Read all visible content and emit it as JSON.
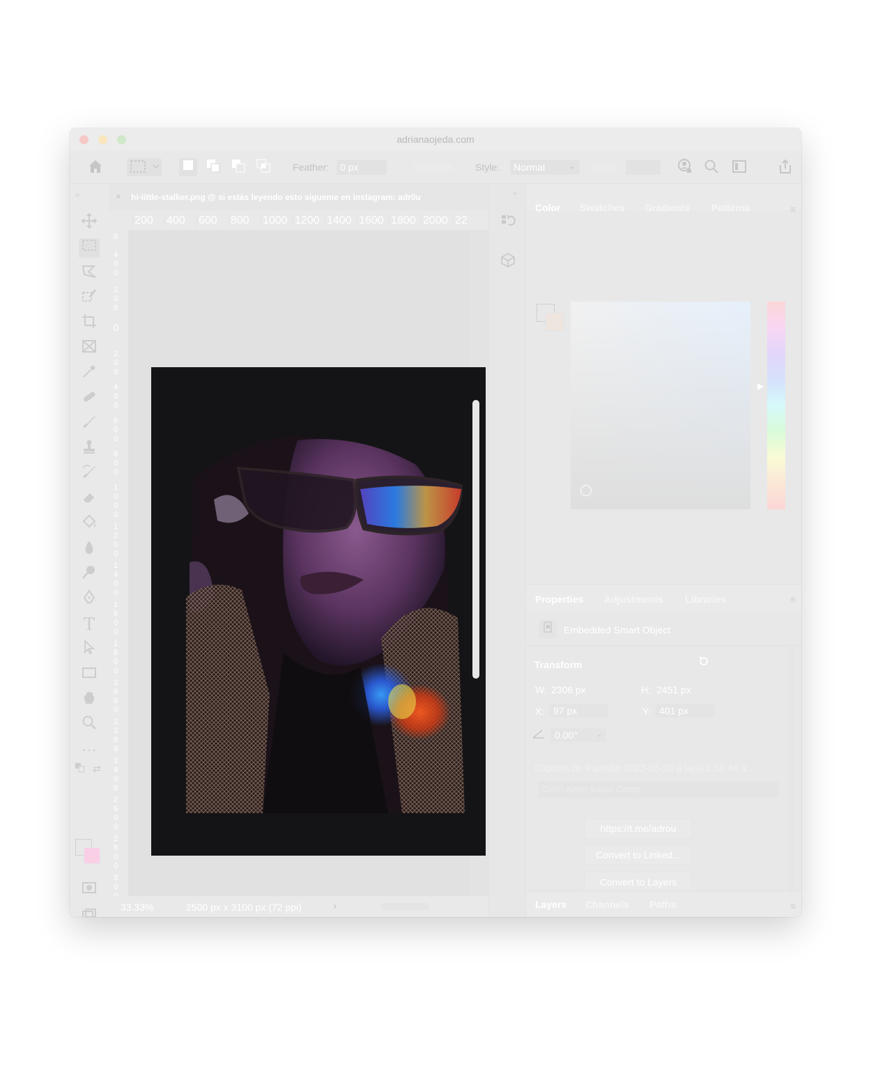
{
  "window": {
    "title": "adrianaojeda.com"
  },
  "options_bar": {
    "feather_label": "Feather:",
    "feather_value": "0 px",
    "antialias_label": "Anti-alias",
    "style_label": "Style:",
    "style_value": "Normal",
    "width_label": "Width:"
  },
  "document": {
    "tab_close": "×",
    "tab_title": "hi-little-stalker.png @ si estás leyendo esto sigueme en instagram: adr0u",
    "ruler_h": [
      "200",
      "400",
      "600",
      "800",
      "1000",
      "1200",
      "1400",
      "1600",
      "1800",
      "2000",
      "22"
    ],
    "ruler_v": [
      "0",
      "400",
      "200",
      "0",
      "200",
      "400",
      "600",
      "800",
      "1000",
      "1200",
      "1400",
      "1600",
      "1800",
      "2000",
      "2200",
      "2400",
      "2600",
      "2800",
      "3000",
      "3200",
      "3400"
    ]
  },
  "status_bar": {
    "zoom": "33.33%",
    "info": "2500 px x 3100 px (72 ppi)",
    "arrow": "›"
  },
  "color_panel": {
    "tabs": [
      "Color",
      "Swatches",
      "Gradients",
      "Patterns"
    ],
    "menu_icon": "≡",
    "foreground": "#e8e8e8",
    "background": "#efe5df"
  },
  "properties_panel": {
    "tabs": [
      "Properties",
      "Adjustments",
      "Libraries"
    ],
    "menu_icon": "≡",
    "object_type": "Embedded Smart Object",
    "transform_heading": "Transform",
    "w_label": "W:",
    "w_value": "2306 px",
    "h_label": "H:",
    "h_value": "2451 px",
    "x_label": "X:",
    "x_value": "97 px",
    "y_label": "Y:",
    "y_value": "401 px",
    "angle_value": "0.00°",
    "source_name": "Captura de Pantalla 2022-05-28 a la(s) 1.58.46 a...",
    "layer_comp_placeholder": "Don't Apply Layer Comp",
    "buttons": [
      "https://t.me/adrou",
      "Convert to Linked...",
      "Convert to Layers"
    ]
  },
  "layers_panel": {
    "tabs": [
      "Layers",
      "Channels",
      "Paths"
    ],
    "menu_icon": "≡"
  }
}
